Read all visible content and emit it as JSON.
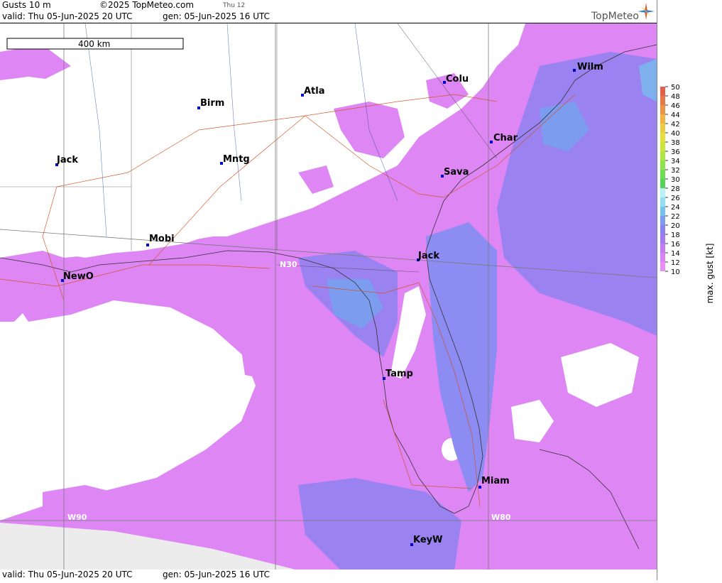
{
  "header": {
    "product": "Gusts 10 m",
    "copyright": "©2025 TopMeteo.com",
    "day_tab": "Thu 12",
    "valid": "valid:  Thu  05-Jun-2025  20 UTC",
    "generated": "gen: 05-Jun-2025 16 UTC",
    "brand": "TopMeteo"
  },
  "footer": {
    "valid": "valid:  Thu  05-Jun-2025  20 UTC",
    "generated": "gen: 05-Jun-2025 16 UTC"
  },
  "map": {
    "scale_label": "400 km",
    "cities": [
      {
        "name": "Wilm"
      },
      {
        "name": "Colu"
      },
      {
        "name": "Atla"
      },
      {
        "name": "Birm"
      },
      {
        "name": "Char"
      },
      {
        "name": "Sava"
      },
      {
        "name": "Jack"
      },
      {
        "name": "Mntg"
      },
      {
        "name": "Mobi"
      },
      {
        "name": "NewO"
      },
      {
        "name": "Jack"
      },
      {
        "name": "Tamp"
      },
      {
        "name": "Miam"
      },
      {
        "name": "KeyW"
      }
    ],
    "graticule_labels": {
      "n30": "N30",
      "w90": "W90",
      "w80": "W80"
    }
  },
  "legend": {
    "title": "max. gust  [kt]",
    "ticks": [
      "50",
      "48",
      "46",
      "44",
      "42",
      "40",
      "38",
      "36",
      "34",
      "32",
      "30",
      "28",
      "26",
      "24",
      "22",
      "20",
      "18",
      "16",
      "14",
      "12",
      "10"
    ],
    "colors": [
      "#e0604a",
      "#e7784a",
      "#ec9445",
      "#efb243",
      "#eccc40",
      "#e3e03e",
      "#cbe53e",
      "#aee644",
      "#8ee24c",
      "#6fdc52",
      "#55d45a",
      "#b8f2f7",
      "#93def2",
      "#78c0ee",
      "#7c9cf0",
      "#8a82f0",
      "#a47af0",
      "#c27cf2",
      "#d884f4",
      "#e88ef6"
    ]
  }
}
